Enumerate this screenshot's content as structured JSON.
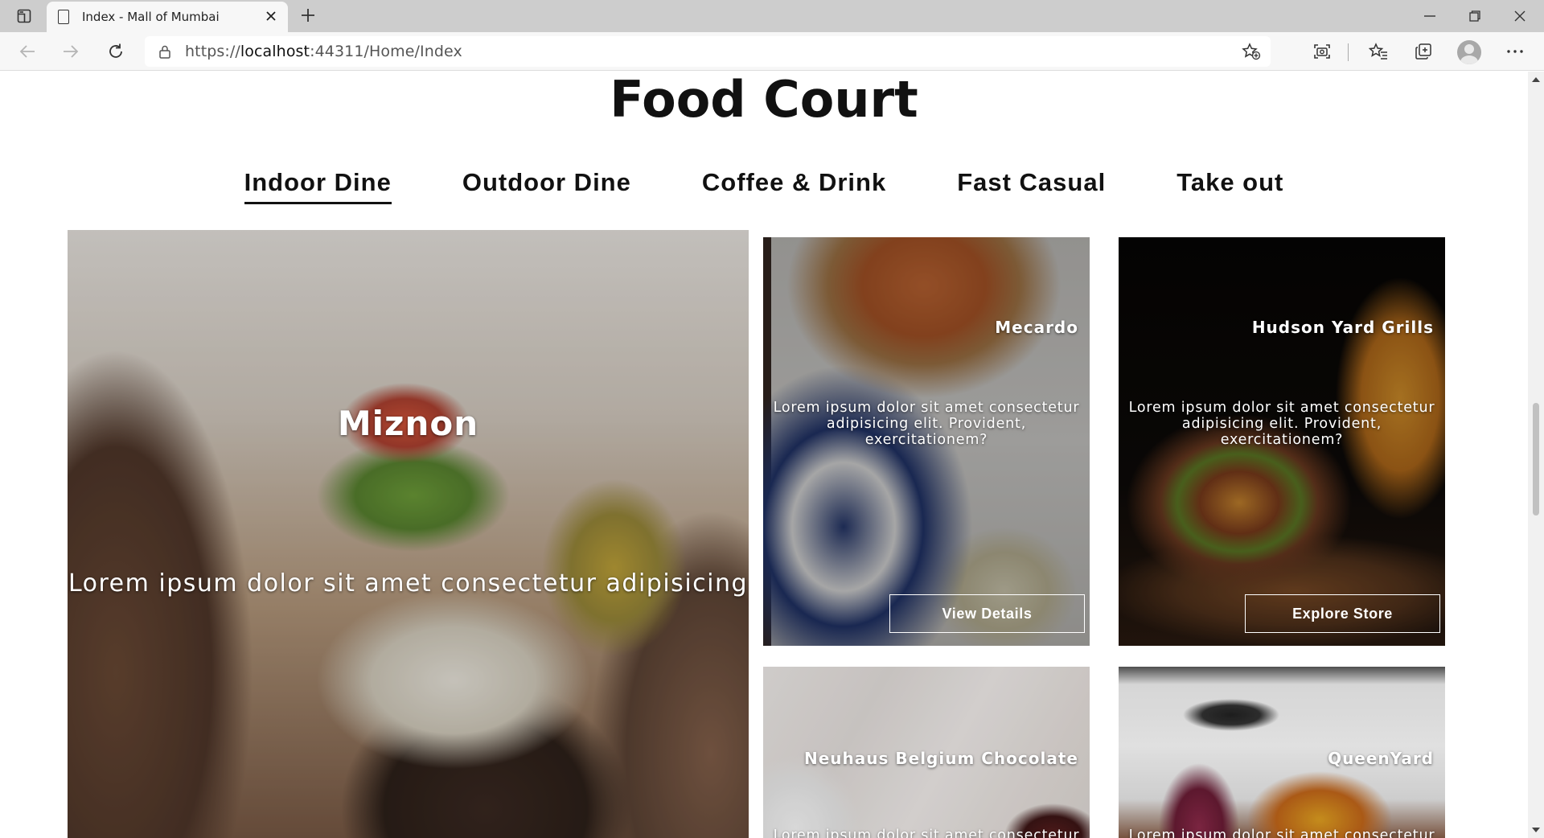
{
  "browser": {
    "tab_title": "Index - Mall of Mumbai",
    "url_prefix": "https://",
    "url_host": "localhost",
    "url_rest": ":44311/Home/Index"
  },
  "page": {
    "heading": "Food Court",
    "categories": [
      {
        "label": "Indoor Dine",
        "active": true
      },
      {
        "label": "Outdoor Dine",
        "active": false
      },
      {
        "label": "Coffee & Drink",
        "active": false
      },
      {
        "label": "Fast Casual",
        "active": false
      },
      {
        "label": "Take out",
        "active": false
      }
    ],
    "stores": {
      "miznon": {
        "name": "Miznon",
        "desc": "Lorem ipsum dolor sit amet consectetur adipisicing"
      },
      "mecardo": {
        "name": "Mecardo",
        "desc": "Lorem ipsum dolor sit amet consectetur adipisicing elit. Provident, exercitationem?",
        "button": "View Details"
      },
      "hudson": {
        "name": "Hudson Yard Grills",
        "desc": "Lorem ipsum dolor sit amet consectetur adipisicing elit. Provident, exercitationem?",
        "button": "Explore Store"
      },
      "neuhaus": {
        "name": "Neuhaus Belgium Chocolate",
        "desc": "Lorem ipsum dolor sit amet consectetur"
      },
      "queen": {
        "name": "QueenYard",
        "desc": "Lorem ipsum dolor sit amet consectetur"
      }
    }
  },
  "icons": {
    "tab_actions": "tab-actions-icon",
    "page": "page-icon",
    "close": "close-icon",
    "new_tab": "plus-icon",
    "minimize": "minimize-icon",
    "restore": "restore-icon",
    "window_close": "close-icon",
    "back": "back-arrow-icon",
    "forward": "forward-arrow-icon",
    "refresh": "refresh-icon",
    "lock": "lock-icon",
    "add_favorite": "star-plus-icon",
    "screenshot": "camera-icon",
    "favorites": "favorites-icon",
    "collections": "collections-icon",
    "profile": "avatar-icon",
    "more": "more-icon"
  },
  "colors": {
    "text_primary": "#111111",
    "chrome_tabbar": "#cdcdcd",
    "chrome_toolbar": "#f7f7f7"
  }
}
